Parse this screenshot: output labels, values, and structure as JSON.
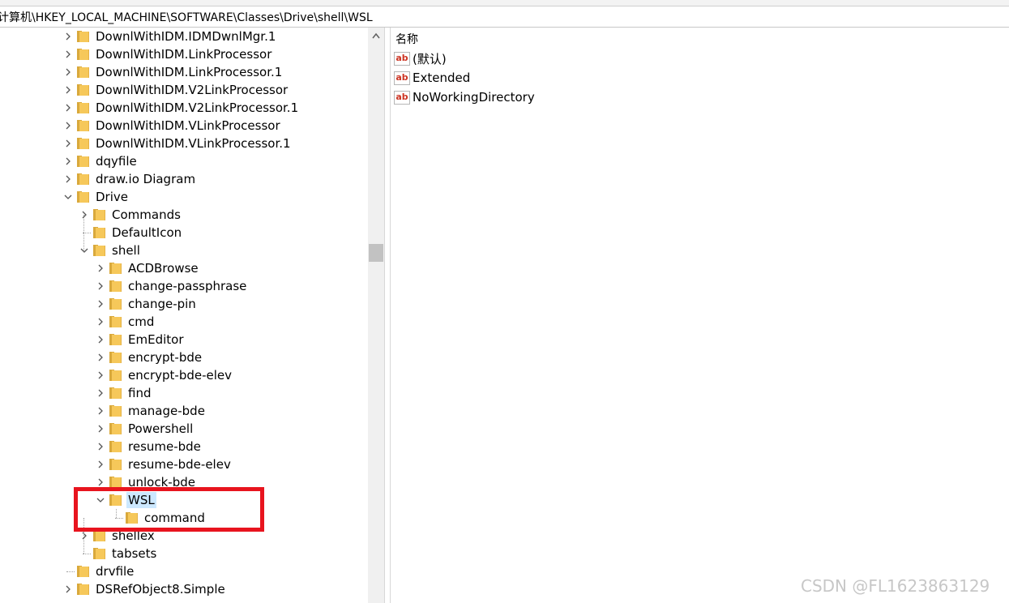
{
  "address_bar": {
    "path": "计算机\\HKEY_LOCAL_MACHINE\\SOFTWARE\\Classes\\Drive\\shell\\WSL"
  },
  "tree": [
    {
      "label": "DownlWithIDM.IDMDwnlMgr.1",
      "expander": "collapsed"
    },
    {
      "label": "DownlWithIDM.LinkProcessor",
      "expander": "collapsed"
    },
    {
      "label": "DownlWithIDM.LinkProcessor.1",
      "expander": "collapsed"
    },
    {
      "label": "DownlWithIDM.V2LinkProcessor",
      "expander": "collapsed"
    },
    {
      "label": "DownlWithIDM.V2LinkProcessor.1",
      "expander": "collapsed"
    },
    {
      "label": "DownlWithIDM.VLinkProcessor",
      "expander": "collapsed"
    },
    {
      "label": "DownlWithIDM.VLinkProcessor.1",
      "expander": "collapsed"
    },
    {
      "label": "dqyfile",
      "expander": "collapsed"
    },
    {
      "label": "draw.io Diagram",
      "expander": "collapsed"
    },
    {
      "label": "Drive",
      "expander": "expanded"
    },
    {
      "label": "Commands",
      "expander": "collapsed"
    },
    {
      "label": "DefaultIcon",
      "expander": "none"
    },
    {
      "label": "shell",
      "expander": "expanded"
    },
    {
      "label": "ACDBrowse",
      "expander": "collapsed"
    },
    {
      "label": "change-passphrase",
      "expander": "collapsed"
    },
    {
      "label": "change-pin",
      "expander": "collapsed"
    },
    {
      "label": "cmd",
      "expander": "collapsed"
    },
    {
      "label": "EmEditor",
      "expander": "collapsed"
    },
    {
      "label": "encrypt-bde",
      "expander": "collapsed"
    },
    {
      "label": "encrypt-bde-elev",
      "expander": "collapsed"
    },
    {
      "label": "find",
      "expander": "collapsed"
    },
    {
      "label": "manage-bde",
      "expander": "collapsed"
    },
    {
      "label": "Powershell",
      "expander": "collapsed"
    },
    {
      "label": "resume-bde",
      "expander": "collapsed"
    },
    {
      "label": "resume-bde-elev",
      "expander": "collapsed"
    },
    {
      "label": "unlock-bde",
      "expander": "collapsed"
    },
    {
      "label": "WSL",
      "expander": "expanded",
      "selected": true
    },
    {
      "label": "command",
      "expander": "none"
    },
    {
      "label": "shellex",
      "expander": "collapsed"
    },
    {
      "label": "tabsets",
      "expander": "none"
    },
    {
      "label": "drvfile",
      "expander": "none"
    },
    {
      "label": "DSRefObject8.Simple",
      "expander": "collapsed"
    }
  ],
  "values_pane": {
    "column_name": "名称",
    "values": [
      {
        "name": "(默认)",
        "icon": "string-value-icon"
      },
      {
        "name": "Extended",
        "icon": "string-value-icon"
      },
      {
        "name": "NoWorkingDirectory",
        "icon": "string-value-icon"
      }
    ]
  },
  "watermark": "CSDN @FL1623863129",
  "colors": {
    "highlight_box": "#e8141e",
    "selection": "#cce8ff",
    "folder": "#f6c85a"
  }
}
